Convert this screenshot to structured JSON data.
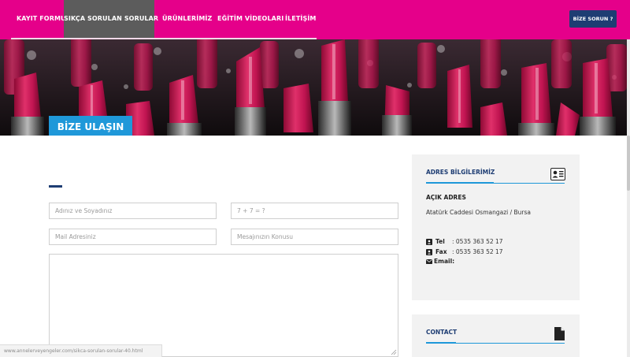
{
  "nav": {
    "items": [
      {
        "label": "KAYIT FORMU",
        "active": false
      },
      {
        "label": "SIKÇA SORULAN SORULAR",
        "active": true
      },
      {
        "label": "ÜRÜNLERİMİZ",
        "active": false
      },
      {
        "label": "EĞİTİM VİDEOLARI",
        "active": false
      },
      {
        "label": "İLETİŞİM",
        "active": false
      }
    ],
    "cta_label": "BİZE SORUN ?"
  },
  "hero": {
    "title": "BİZE ULAŞIN",
    "background_icon": "lipstick-banner-image"
  },
  "form": {
    "name_placeholder": "Adınız ve Soyadınız",
    "captcha_placeholder": "7 + 7 = ?",
    "email_placeholder": "Mail Adresiniz",
    "subject_placeholder": "Mesajınızın Konusu",
    "message_placeholder": ""
  },
  "address_panel": {
    "title": "ADRES BİLGİLERİMİZ",
    "icon": "contact-card-icon",
    "address_heading": "AÇIK ADRES",
    "address": "Atatürk Caddesi Osmangazi / Bursa",
    "phone_label": "Tel",
    "phone_value": ": 0535 363 52 17",
    "fax_label": "Fax",
    "fax_value": ": 0535 363 52 17",
    "email_label": "Email:",
    "email_value": ""
  },
  "contact_panel": {
    "title": "CONTACT",
    "icon": "document-icon"
  },
  "status_bar": {
    "url": "www.annelerveyengeler.com/sikca-sorulan-sorular-40.html"
  },
  "colors": {
    "brand_pink": "#e5008a",
    "active_nav": "#5c5c5c",
    "navy": "#1e3d73",
    "accent_blue": "#1f98d9",
    "panel_bg": "#f2f2f2"
  }
}
